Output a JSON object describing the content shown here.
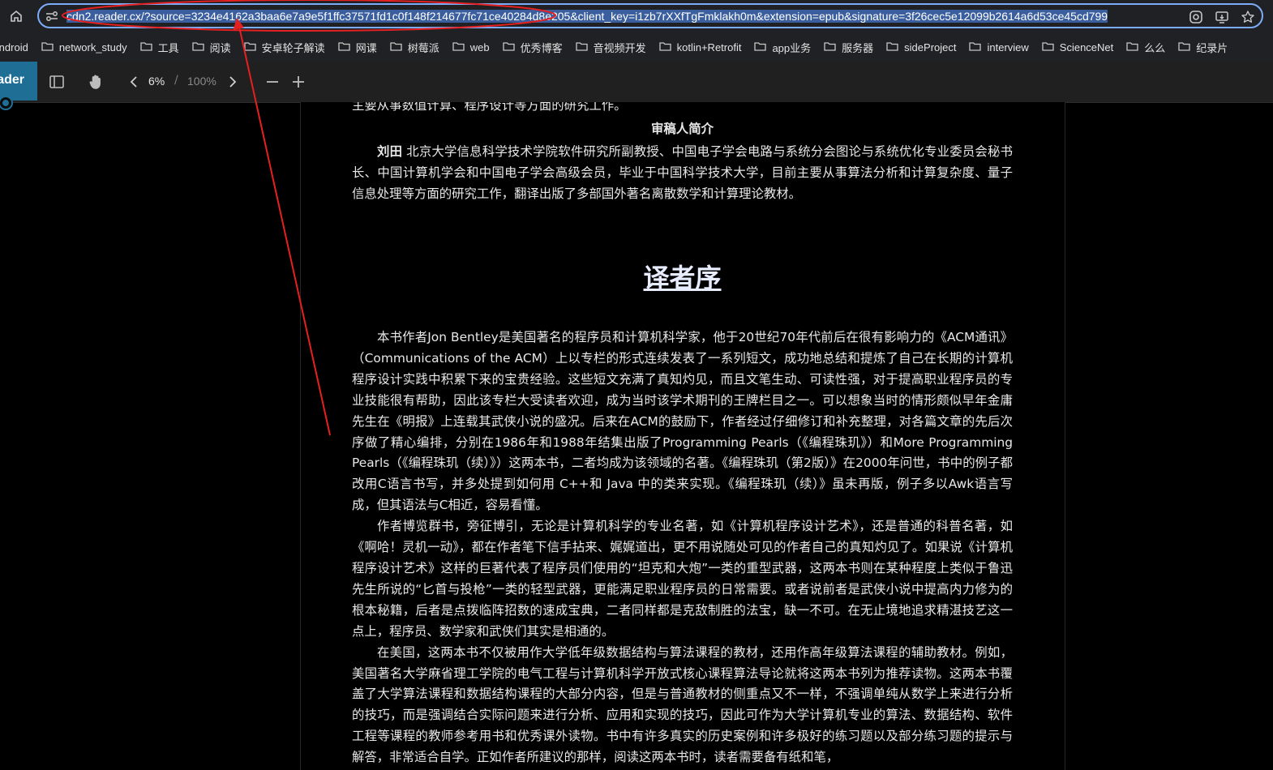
{
  "browser": {
    "url": "cdn2.reader.cx/?source=3234e4162a3baa6e7a9e5f1ffc37571fd1c0f148f214677fc71ce40284d8e205&client_key=i1zb7rXXfTgFmklakh0m&extension=epub&signature=3f26cec5e12099b2614a6d53ce45cd799",
    "omnibox_icons": [
      "site-info-icon",
      "google-lens-icon",
      "install-app-icon",
      "bookmark-star-icon"
    ]
  },
  "bookmarks": [
    "Android",
    "network_study",
    "工具",
    "阅读",
    "安卓轮子解读",
    "网课",
    "树莓派",
    "web",
    "优秀博客",
    "音视频开发",
    "kotlin+Retrofit",
    "app业务",
    "服务器",
    "sideProject",
    "interview",
    "ScienceNet",
    "么么",
    "纪录片"
  ],
  "reader": {
    "brand": "Reader",
    "page_now": "6%",
    "page_sep": "/",
    "page_total": "100%",
    "accent": "#1e6e96"
  },
  "document": {
    "cut_line": "主要从事数值计算、程序设计等方面的研究工作。",
    "section_heading": "审稿人简介",
    "bio_name": "刘田",
    "bio_text": " 北京大学信息科学技术学院软件研究所副教授、中国电子学会电路与系统分会图论与系统优化专业委员会秘书长、中国计算机学会和中国电子学会高级会员，毕业于中国科学技术大学，目前主要从事算法分析和计算复杂度、量子信息处理等方面的研究工作，翻译出版了多部国外著名离散数学和计算理论教材。",
    "chapter_title": "译者序",
    "paragraphs": [
      "本书作者Jon Bentley是美国著名的程序员和计算机科学家，他于20世纪70年代前后在很有影响力的《ACM通讯》（Communications of the ACM）上以专栏的形式连续发表了一系列短文，成功地总结和提炼了自己在长期的计算机程序设计实践中积累下来的宝贵经验。这些短文充满了真知灼见，而且文笔生动、可读性强，对于提高职业程序员的专业技能很有帮助，因此该专栏大受读者欢迎，成为当时该学术期刊的王牌栏目之一。可以想象当时的情形颇似早年金庸先生在《明报》上连载其武侠小说的盛况。后来在ACM的鼓励下，作者经过仔细修订和补充整理，对各篇文章的先后次序做了精心编排，分别在1986年和1988年结集出版了Programming Pearls（《编程珠玑》）和More Programming Pearls（《编程珠玑（续）》）这两本书，二者均成为该领域的名著。《编程珠玑（第2版）》在2000年问世，书中的例子都改用C语言书写，并多处提到如何用 C++和 Java 中的类来实现。《编程珠玑（续）》虽未再版，例子多以Awk语言写成，但其语法与C相近，容易看懂。",
      "作者博览群书，旁征博引，无论是计算机科学的专业名著，如《计算机程序设计艺术》，还是普通的科普名著，如《啊哈！灵机一动》，都在作者笔下信手拈来、娓娓道出，更不用说随处可见的作者自己的真知灼见了。如果说《计算机程序设计艺术》这样的巨著代表了程序员们使用的“坦克和大炮”一类的重型武器，这两本书则在某种程度上类似于鲁迅先生所说的“匕首与投枪”一类的轻型武器，更能满足职业程序员的日常需要。或者说前者是武侠小说中提高内力修为的根本秘籍，后者是点拨临阵招数的速成宝典，二者同样都是克敌制胜的法宝，缺一不可。在无止境地追求精湛技艺这一点上，程序员、数学家和武侠们其实是相通的。",
      "在美国，这两本书不仅被用作大学低年级数据结构与算法课程的教材，还用作高年级算法课程的辅助教材。例如，美国著名大学麻省理工学院的电气工程与计算机科学开放式核心课程算法导论就将这两本书列为推荐读物。这两本书覆盖了大学算法课程和数据结构课程的大部分内容，但是与普通教材的侧重点又不一样，不强调单纯从数学上来进行分析的技巧，而是强调结合实际问题来进行分析、应用和实现的技巧，因此可作为大学计算机专业的算法、数据结构、软件工程等课程的教师参考用书和优秀课外读物。书中有许多真实的历史案例和许多极好的练习题以及部分练习题的提示与解答，非常适合自学。正如作者所建议的那样，阅读这两本书时，读者需要备有纸和笔，"
    ]
  },
  "annotation": {
    "color": "#e52020"
  }
}
